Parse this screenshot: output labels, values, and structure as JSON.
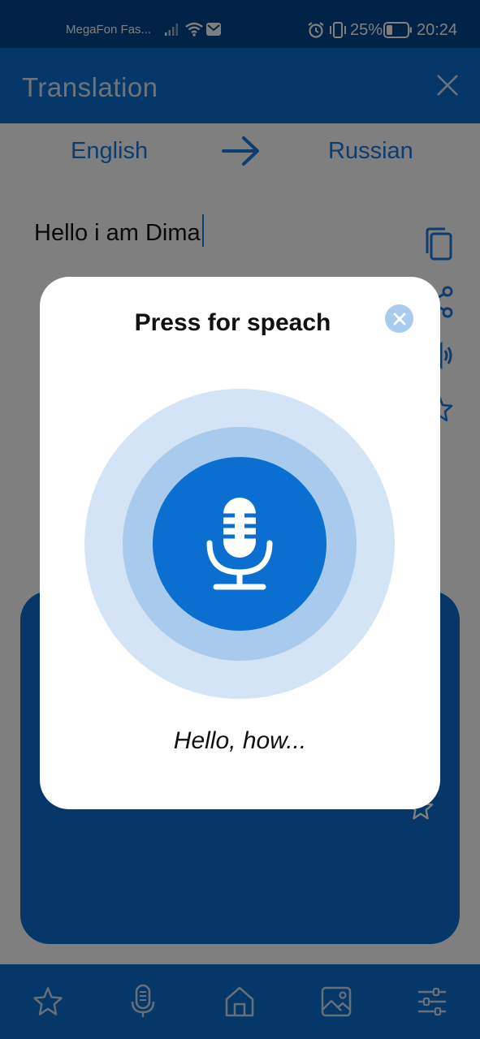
{
  "status_bar": {
    "carrier": "MegaFon Fas...",
    "battery_percent": "25%",
    "time": "20:24"
  },
  "app_bar": {
    "title": "Translation"
  },
  "languages": {
    "source": "English",
    "target": "Russian"
  },
  "input": {
    "text": "Hello i am Dima"
  },
  "dialog": {
    "title": "Press for speach",
    "recognized_text": "Hello, how..."
  },
  "colors": {
    "primary": "#0a6fd0",
    "status_bar": "#00478f",
    "ring_outer": "#d2e4f5",
    "ring_inner": "#a8caec",
    "close_badge": "#a9ccee"
  },
  "icons": {
    "app_close": "close-icon",
    "swap": "arrow-right-icon",
    "copy": "copy-icon",
    "share": "share-icon",
    "speak": "speaker-icon",
    "favorite": "star-icon",
    "mic": "microphone-icon",
    "nav": [
      "star-icon",
      "microphone-icon",
      "home-icon",
      "image-icon",
      "sliders-icon"
    ]
  }
}
